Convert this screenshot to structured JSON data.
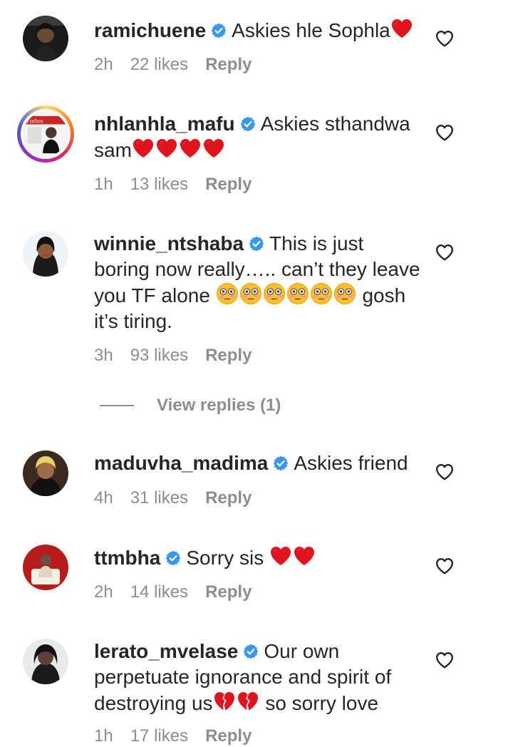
{
  "comments": [
    {
      "username": "ramichuene",
      "text": "Askies hle Sophla",
      "emojis": [
        "red-heart"
      ],
      "time": "2h",
      "likes": "22 likes",
      "reply": "Reply"
    },
    {
      "username": "nhlanhla_mafu",
      "text": "Askies sthandwa sam",
      "emojis": [
        "red-heart",
        "red-heart",
        "red-heart",
        "red-heart"
      ],
      "time": "1h",
      "likes": "13 likes",
      "reply": "Reply"
    },
    {
      "username": "winnie_ntshaba",
      "text_before": "This is just boring now really….. can’t they leave you TF alone",
      "emojis": [
        "flushed-face",
        "flushed-face",
        "flushed-face",
        "flushed-face",
        "flushed-face",
        "flushed-face"
      ],
      "text_after": "gosh it’s tiring.",
      "time": "3h",
      "likes": "93 likes",
      "reply": "Reply",
      "view_replies": "View replies (1)"
    },
    {
      "username": "maduvha_madima",
      "text": "Askies friend",
      "time": "4h",
      "likes": "31 likes",
      "reply": "Reply"
    },
    {
      "username": "ttmbha",
      "text": "Sorry sis",
      "emojis": [
        "red-heart",
        "red-heart"
      ],
      "time": "2h",
      "likes": "14 likes",
      "reply": "Reply"
    },
    {
      "username": "lerato_mvelase",
      "text_before": "Our own perpetuate ignorance and spirit of destroying us",
      "emojis": [
        "broken-heart",
        "broken-heart"
      ],
      "text_after": "so sorry love",
      "time": "1h",
      "likes": "17 likes",
      "reply": "Reply"
    }
  ],
  "icons": {
    "verified": "verified-badge-icon",
    "like": "heart-outline-icon"
  },
  "colors": {
    "verified_blue": "#3897f0",
    "muted_text": "#8e8e8e",
    "primary_text": "#262626",
    "heart_red": "#e0141e"
  }
}
